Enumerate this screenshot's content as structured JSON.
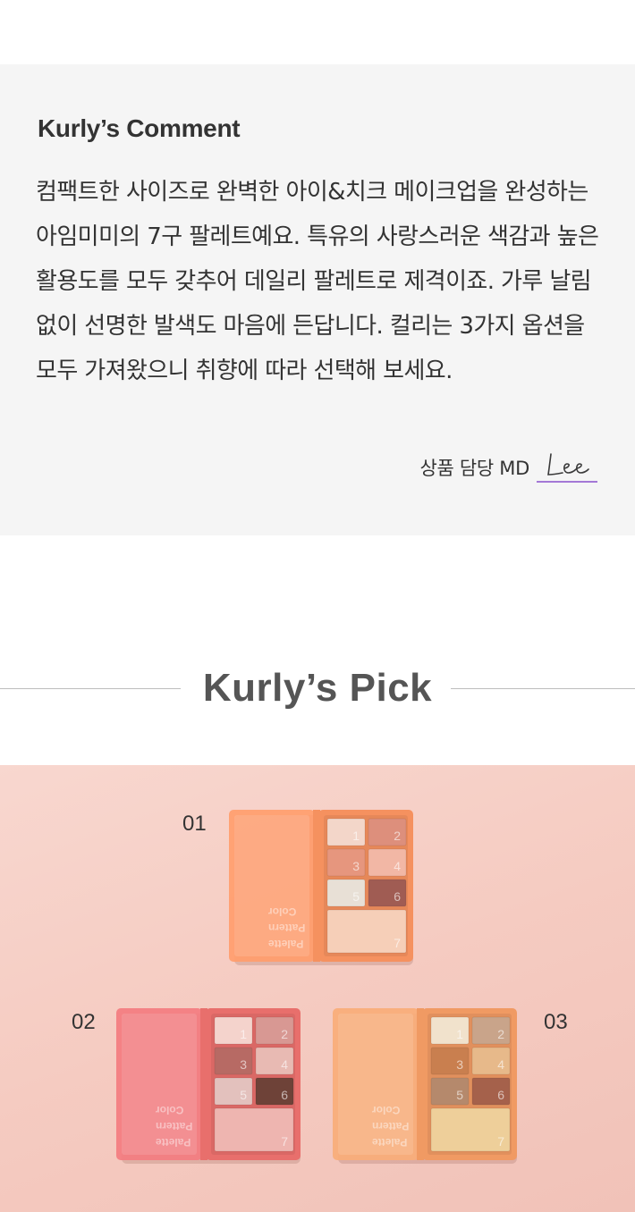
{
  "comment": {
    "title": "Kurly’s Comment",
    "body": "컴팩트한 사이즈로 완벽한 아이&치크 메이크업을 완성하는 아임미미의 7구 팔레트예요. 특유의 사랑스러운 색감과 높은 활용도를 모두 갖추어 데일리 팔레트로 제격이죠. 가루 날림 없이 선명한 발색도 마음에 든답니다. 컬리는 3가지 옵션을 모두 가져왔으니 취향에 따라 선택해 보세요.",
    "md_label": "상품 담당 MD",
    "signature": "Lee",
    "signature_color": "#a478d6"
  },
  "pick": {
    "title": "Kurly’s Pick"
  },
  "photo": {
    "background": "#f5cbc1",
    "palettes": [
      {
        "number": "01",
        "case_color": "#f5915f",
        "lid_color": "#ff9d6c",
        "shades": [
          "#f3d6c9",
          "#dd8f7c",
          "#e6967e",
          "#f2b7a5",
          "#e8e0d6",
          "#a05c53",
          "#f6cfb8"
        ],
        "slot_labels": [
          "1",
          "2",
          "3",
          "4",
          "5",
          "6",
          "7"
        ]
      },
      {
        "number": "02",
        "case_color": "#e86f6c",
        "lid_color": "#f37c80",
        "shades": [
          "#f4d3cc",
          "#d89893",
          "#b76a64",
          "#e8bab3",
          "#e3c1bd",
          "#6e4238",
          "#eeb5b0"
        ],
        "slot_labels": [
          "1",
          "2",
          "3",
          "4",
          "5",
          "6",
          "7"
        ]
      },
      {
        "number": "03",
        "case_color": "#f09a63",
        "lid_color": "#f8ad78",
        "shades": [
          "#f1e2cc",
          "#c9a48a",
          "#c97f4f",
          "#e7b98a",
          "#b5896c",
          "#a5614b",
          "#eecf9a"
        ],
        "slot_labels": [
          "1",
          "2",
          "3",
          "4",
          "5",
          "6",
          "7"
        ]
      }
    ],
    "lid_text": [
      "Color",
      "Pattern",
      "Palette"
    ]
  }
}
